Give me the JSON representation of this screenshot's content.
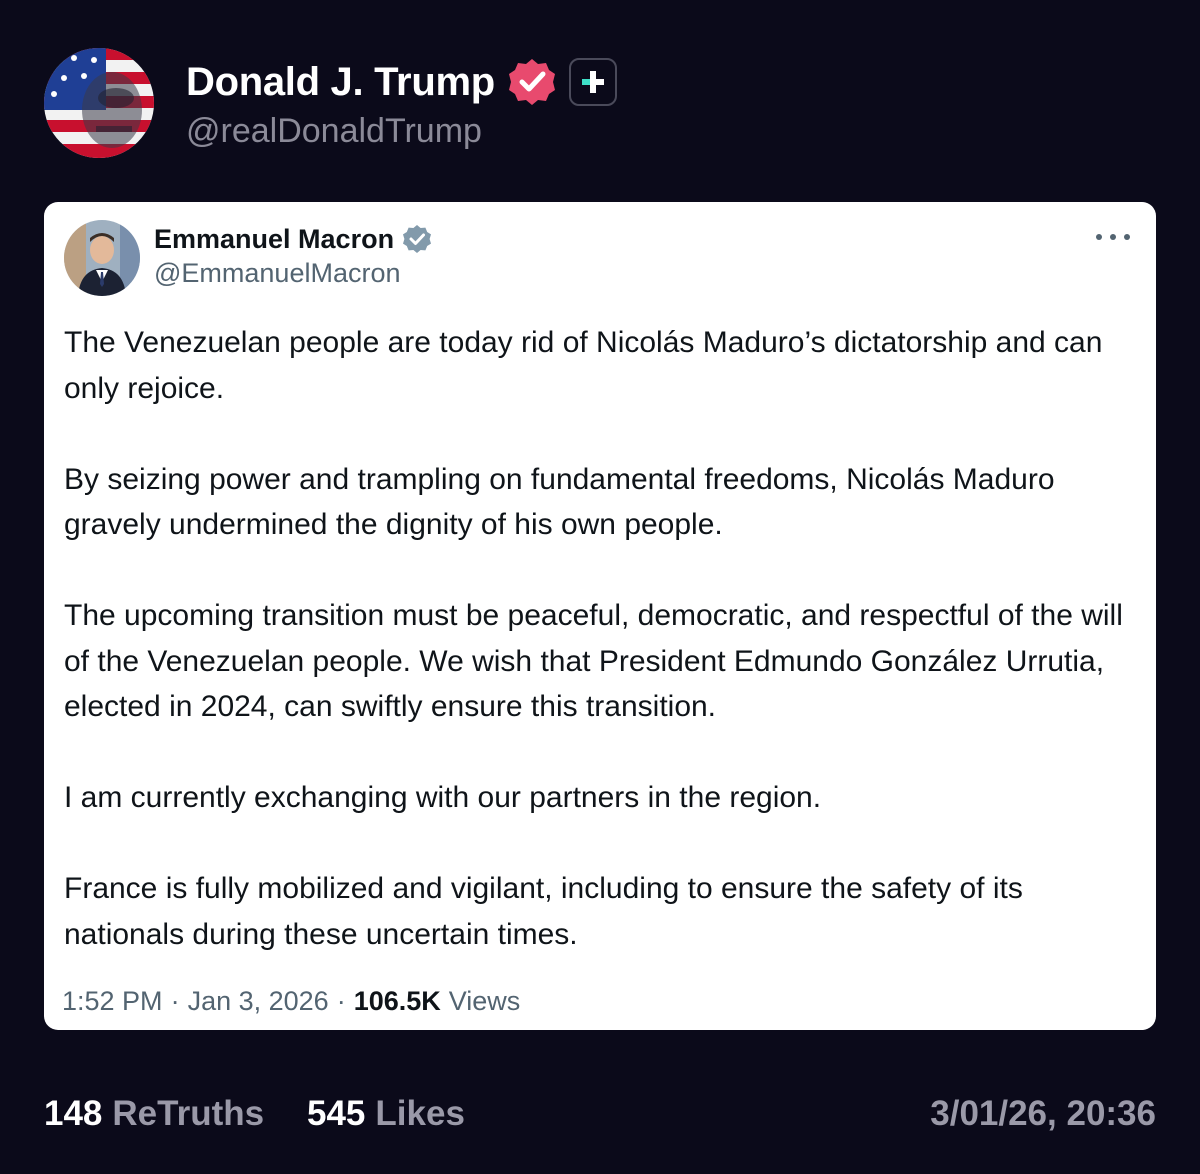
{
  "post": {
    "author_name": "Donald J. Trump",
    "author_handle": "@realDonaldTrump",
    "timestamp": "3/01/26, 20:36"
  },
  "embedded": {
    "author_name": "Emmanuel Macron",
    "author_handle": "@EmmanuelMacron",
    "paragraphs": [
      "The Venezuelan people are today rid of Nicolás Maduro’s dictatorship and can only rejoice.",
      "By seizing power and trampling on fundamental freedoms, Nicolás Maduro gravely undermined the dignity of his own people.",
      "The upcoming transition must be peaceful, democratic, and respectful of the will of the Venezuelan people. We wish that President Edmundo González Urrutia, elected in 2024, can swiftly ensure this transition.",
      "I am currently exchanging with our partners in the region.",
      "France is fully mobilized and vigilant, including to ensure the safety of its nationals during these uncertain times."
    ],
    "time": "1:52 PM",
    "date": "Jan 3, 2026",
    "views_count": "106.5K",
    "views_label": "Views",
    "separator": "·"
  },
  "stats": {
    "retruths_count": "148",
    "retruths_label": "ReTruths",
    "likes_count": "545",
    "likes_label": "Likes"
  },
  "icons": {
    "main_verified": "verified-badge-icon",
    "plus": "plus-icon",
    "card_verified": "verified-badge-icon",
    "more": "more-options-icon"
  },
  "colors": {
    "background": "#0b0a1a",
    "verified_pink": "#e84a6e",
    "plus_teal": "#3ee0c8",
    "card_verified_gray": "#829aab",
    "muted_text": "#9a99a8"
  }
}
